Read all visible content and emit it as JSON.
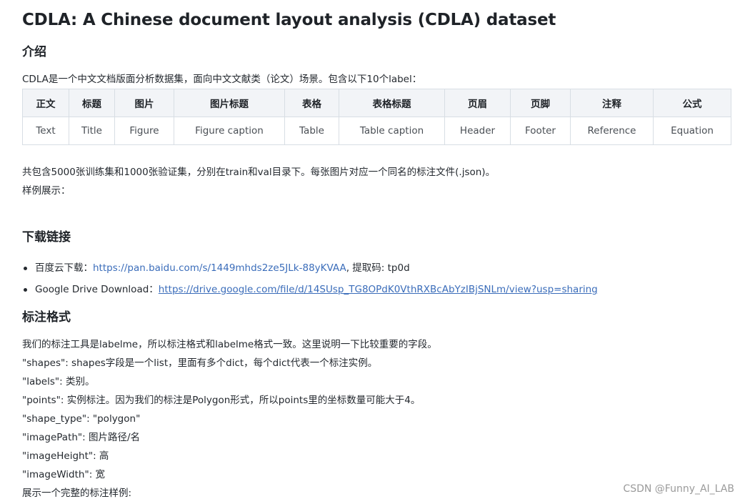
{
  "title": "CDLA: A Chinese document layout analysis (CDLA) dataset",
  "intro": {
    "heading": "介绍",
    "text": "CDLA是一个中文文档版面分析数据集，面向中文文献类（论文）场景。包含以下10个label："
  },
  "label_table": {
    "headers": [
      "正文",
      "标题",
      "图片",
      "图片标题",
      "表格",
      "表格标题",
      "页眉",
      "页脚",
      "注释",
      "公式"
    ],
    "values": [
      "Text",
      "Title",
      "Figure",
      "Figure caption",
      "Table",
      "Table caption",
      "Header",
      "Footer",
      "Reference",
      "Equation"
    ]
  },
  "dataset_info": "共包含5000张训练集和1000张验证集，分别在train和val目录下。每张图片对应一个同名的标注文件(.json)。",
  "sample_label": "样例展示：",
  "download": {
    "heading": "下载链接",
    "baidu_prefix": "百度云下载：",
    "baidu_url": "https://pan.baidu.com/s/1449mhds2ze5JLk-88yKVAA",
    "baidu_suffix": ", 提取码: tp0d",
    "google_prefix": "Google Drive Download：",
    "google_url": "https://drive.google.com/file/d/14SUsp_TG8OPdK0VthRXBcAbYzIBjSNLm/view?usp=sharing"
  },
  "format": {
    "heading": "标注格式",
    "lines": [
      "我们的标注工具是labelme，所以标注格式和labelme格式一致。这里说明一下比较重要的字段。",
      "\"shapes\": shapes字段是一个list，里面有多个dict，每个dict代表一个标注实例。",
      "\"labels\": 类别。",
      "\"points\": 实例标注。因为我们的标注是Polygon形式，所以points里的坐标数量可能大于4。",
      "\"shape_type\": \"polygon\"",
      "\"imagePath\": 图片路径/名",
      "\"imageHeight\": 高",
      "\"imageWidth\": 宽",
      "展示一个完整的标注样例:"
    ]
  },
  "watermark": "CSDN @Funny_AI_LAB"
}
